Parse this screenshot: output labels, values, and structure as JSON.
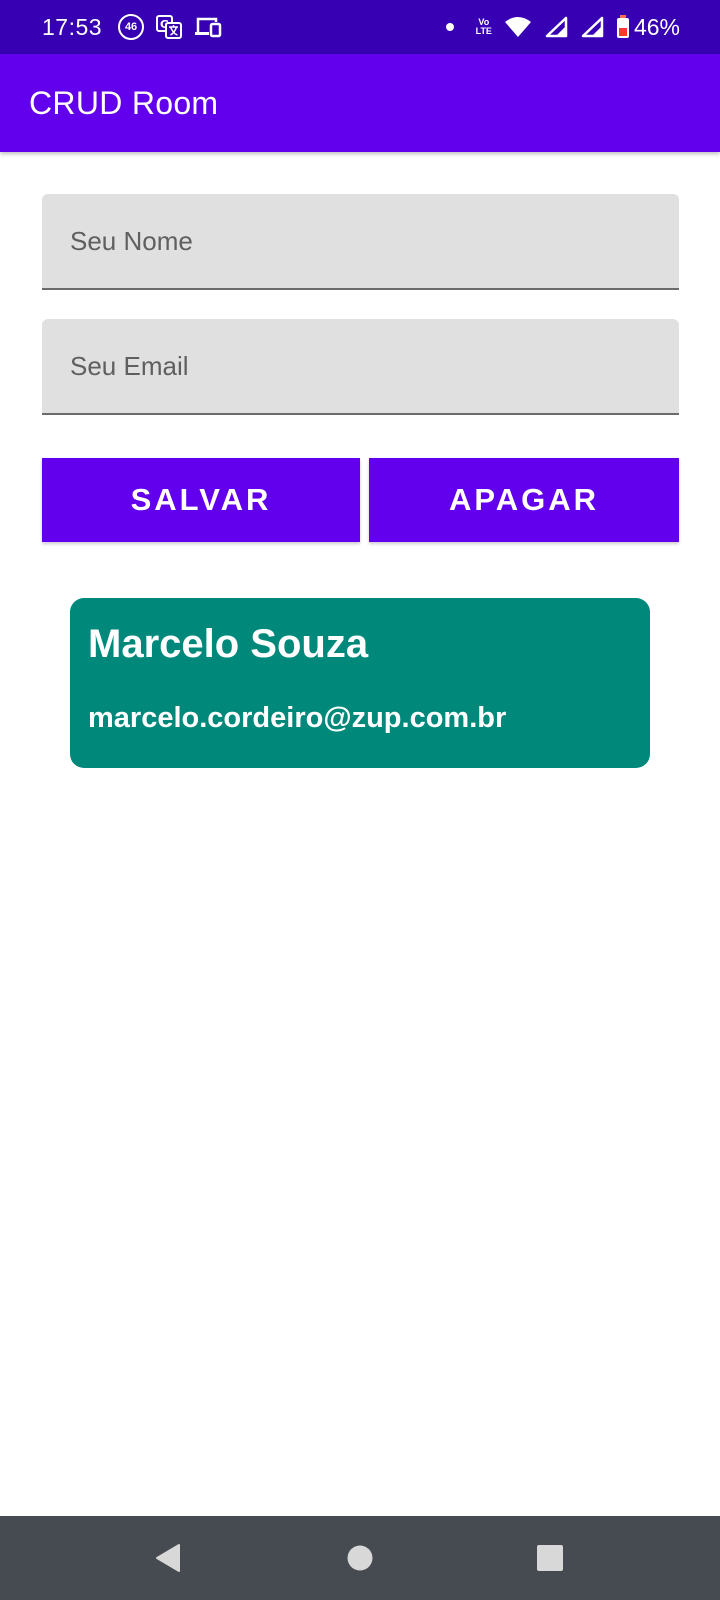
{
  "status_bar": {
    "time": "17:53",
    "network_badge": "46",
    "volte_top": "Vo",
    "volte_bottom": "LTE",
    "battery": "46%",
    "icons": [
      "network-46-icon",
      "translate-icon",
      "cast-devices-icon",
      "notification-dot-icon",
      "volte-icon",
      "wifi-icon",
      "signal-icon",
      "signal-icon",
      "battery-low-icon"
    ]
  },
  "app_bar": {
    "title": "CRUD Room",
    "color": "#6200ee"
  },
  "form": {
    "name_placeholder": "Seu Nome",
    "name_value": "",
    "email_placeholder": "Seu Email",
    "email_value": ""
  },
  "buttons": {
    "save_label": "SALVAR",
    "delete_label": "APAGAR"
  },
  "users": [
    {
      "name": "Marcelo Souza",
      "email": "marcelo.cordeiro@zup.com.br"
    }
  ],
  "colors": {
    "status_bar": "#3700b3",
    "primary": "#6200ee",
    "card": "#00897b",
    "nav_bar": "#454b50"
  },
  "nav": {
    "icons": [
      "back-icon",
      "home-icon",
      "recents-icon"
    ]
  }
}
